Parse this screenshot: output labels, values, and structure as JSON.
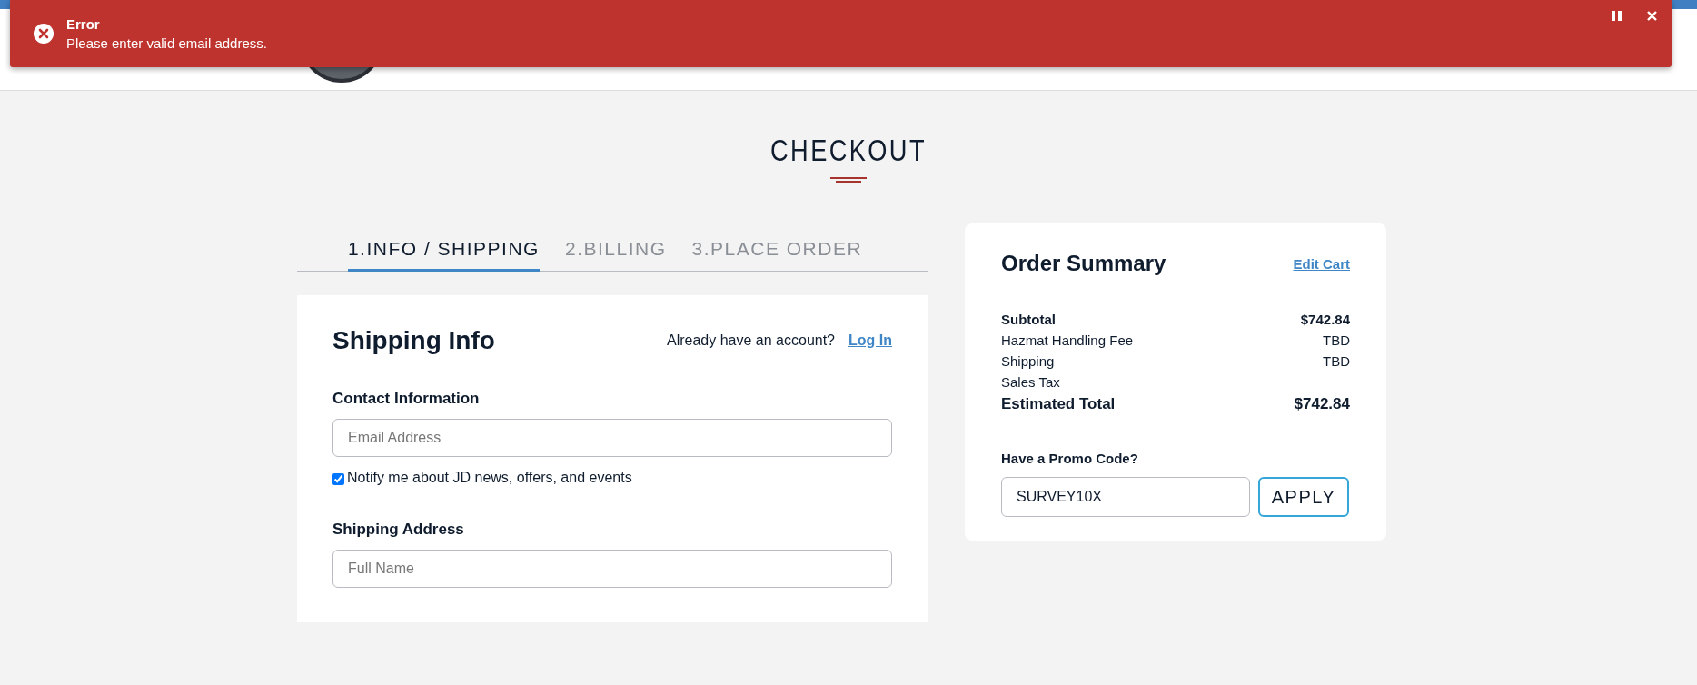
{
  "toast": {
    "title": "Error",
    "message": "Please enter valid email address."
  },
  "page_title": "CHECKOUT",
  "steps": [
    {
      "label": "1.INFO / SHIPPING",
      "selected": true
    },
    {
      "label": "2.BILLING",
      "selected": false
    },
    {
      "label": "3.PLACE ORDER",
      "selected": false
    }
  ],
  "shipping_form": {
    "title": "Shipping Info",
    "account_prompt": "Already have an account?",
    "login_link": "Log In",
    "contact_heading": "Contact Information",
    "email": {
      "placeholder": "Email Address"
    },
    "notify": {
      "label": "Notify me about JD news, offers, and events",
      "checked": true
    },
    "address_heading": "Shipping Address",
    "full_name": {
      "placeholder": "Full Name"
    }
  },
  "order_summary": {
    "title": "Order Summary",
    "edit_link": "Edit Cart",
    "rows": [
      {
        "label": "Subtotal",
        "value": "$742.84",
        "kind": "strong"
      },
      {
        "label": "Hazmat Handling Fee",
        "value": "TBD",
        "kind": "normal"
      },
      {
        "label": "Shipping",
        "value": "TBD",
        "kind": "normal"
      },
      {
        "label": "Sales Tax",
        "kind": "normal"
      },
      {
        "label": "Estimated Total",
        "value": "$742.84",
        "kind": "total"
      }
    ],
    "promo_label": "Have a Promo Code?",
    "promo_code": "SURVEY10X",
    "apply_button": "APPLY"
  }
}
